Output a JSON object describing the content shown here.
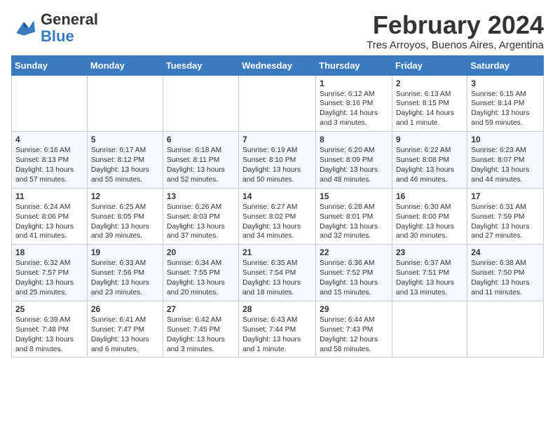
{
  "logo": {
    "text_general": "General",
    "text_blue": "Blue"
  },
  "title": "February 2024",
  "subtitle": "Tres Arroyos, Buenos Aires, Argentina",
  "days_of_week": [
    "Sunday",
    "Monday",
    "Tuesday",
    "Wednesday",
    "Thursday",
    "Friday",
    "Saturday"
  ],
  "weeks": [
    [
      {
        "day": "",
        "info": ""
      },
      {
        "day": "",
        "info": ""
      },
      {
        "day": "",
        "info": ""
      },
      {
        "day": "",
        "info": ""
      },
      {
        "day": "1",
        "info": "Sunrise: 6:12 AM\nSunset: 8:16 PM\nDaylight: 14 hours\nand 3 minutes."
      },
      {
        "day": "2",
        "info": "Sunrise: 6:13 AM\nSunset: 8:15 PM\nDaylight: 14 hours\nand 1 minute."
      },
      {
        "day": "3",
        "info": "Sunrise: 6:15 AM\nSunset: 8:14 PM\nDaylight: 13 hours\nand 59 minutes."
      }
    ],
    [
      {
        "day": "4",
        "info": "Sunrise: 6:16 AM\nSunset: 8:13 PM\nDaylight: 13 hours\nand 57 minutes."
      },
      {
        "day": "5",
        "info": "Sunrise: 6:17 AM\nSunset: 8:12 PM\nDaylight: 13 hours\nand 55 minutes."
      },
      {
        "day": "6",
        "info": "Sunrise: 6:18 AM\nSunset: 8:11 PM\nDaylight: 13 hours\nand 52 minutes."
      },
      {
        "day": "7",
        "info": "Sunrise: 6:19 AM\nSunset: 8:10 PM\nDaylight: 13 hours\nand 50 minutes."
      },
      {
        "day": "8",
        "info": "Sunrise: 6:20 AM\nSunset: 8:09 PM\nDaylight: 13 hours\nand 48 minutes."
      },
      {
        "day": "9",
        "info": "Sunrise: 6:22 AM\nSunset: 8:08 PM\nDaylight: 13 hours\nand 46 minutes."
      },
      {
        "day": "10",
        "info": "Sunrise: 6:23 AM\nSunset: 8:07 PM\nDaylight: 13 hours\nand 44 minutes."
      }
    ],
    [
      {
        "day": "11",
        "info": "Sunrise: 6:24 AM\nSunset: 8:06 PM\nDaylight: 13 hours\nand 41 minutes."
      },
      {
        "day": "12",
        "info": "Sunrise: 6:25 AM\nSunset: 8:05 PM\nDaylight: 13 hours\nand 39 minutes."
      },
      {
        "day": "13",
        "info": "Sunrise: 6:26 AM\nSunset: 8:03 PM\nDaylight: 13 hours\nand 37 minutes."
      },
      {
        "day": "14",
        "info": "Sunrise: 6:27 AM\nSunset: 8:02 PM\nDaylight: 13 hours\nand 34 minutes."
      },
      {
        "day": "15",
        "info": "Sunrise: 6:28 AM\nSunset: 8:01 PM\nDaylight: 13 hours\nand 32 minutes."
      },
      {
        "day": "16",
        "info": "Sunrise: 6:30 AM\nSunset: 8:00 PM\nDaylight: 13 hours\nand 30 minutes."
      },
      {
        "day": "17",
        "info": "Sunrise: 6:31 AM\nSunset: 7:59 PM\nDaylight: 13 hours\nand 27 minutes."
      }
    ],
    [
      {
        "day": "18",
        "info": "Sunrise: 6:32 AM\nSunset: 7:57 PM\nDaylight: 13 hours\nand 25 minutes."
      },
      {
        "day": "19",
        "info": "Sunrise: 6:33 AM\nSunset: 7:56 PM\nDaylight: 13 hours\nand 23 minutes."
      },
      {
        "day": "20",
        "info": "Sunrise: 6:34 AM\nSunset: 7:55 PM\nDaylight: 13 hours\nand 20 minutes."
      },
      {
        "day": "21",
        "info": "Sunrise: 6:35 AM\nSunset: 7:54 PM\nDaylight: 13 hours\nand 18 minutes."
      },
      {
        "day": "22",
        "info": "Sunrise: 6:36 AM\nSunset: 7:52 PM\nDaylight: 13 hours\nand 15 minutes."
      },
      {
        "day": "23",
        "info": "Sunrise: 6:37 AM\nSunset: 7:51 PM\nDaylight: 13 hours\nand 13 minutes."
      },
      {
        "day": "24",
        "info": "Sunrise: 6:38 AM\nSunset: 7:50 PM\nDaylight: 13 hours\nand 11 minutes."
      }
    ],
    [
      {
        "day": "25",
        "info": "Sunrise: 6:39 AM\nSunset: 7:48 PM\nDaylight: 13 hours\nand 8 minutes."
      },
      {
        "day": "26",
        "info": "Sunrise: 6:41 AM\nSunset: 7:47 PM\nDaylight: 13 hours\nand 6 minutes."
      },
      {
        "day": "27",
        "info": "Sunrise: 6:42 AM\nSunset: 7:45 PM\nDaylight: 13 hours\nand 3 minutes."
      },
      {
        "day": "28",
        "info": "Sunrise: 6:43 AM\nSunset: 7:44 PM\nDaylight: 13 hours\nand 1 minute."
      },
      {
        "day": "29",
        "info": "Sunrise: 6:44 AM\nSunset: 7:43 PM\nDaylight: 12 hours\nand 58 minutes."
      },
      {
        "day": "",
        "info": ""
      },
      {
        "day": "",
        "info": ""
      }
    ]
  ]
}
